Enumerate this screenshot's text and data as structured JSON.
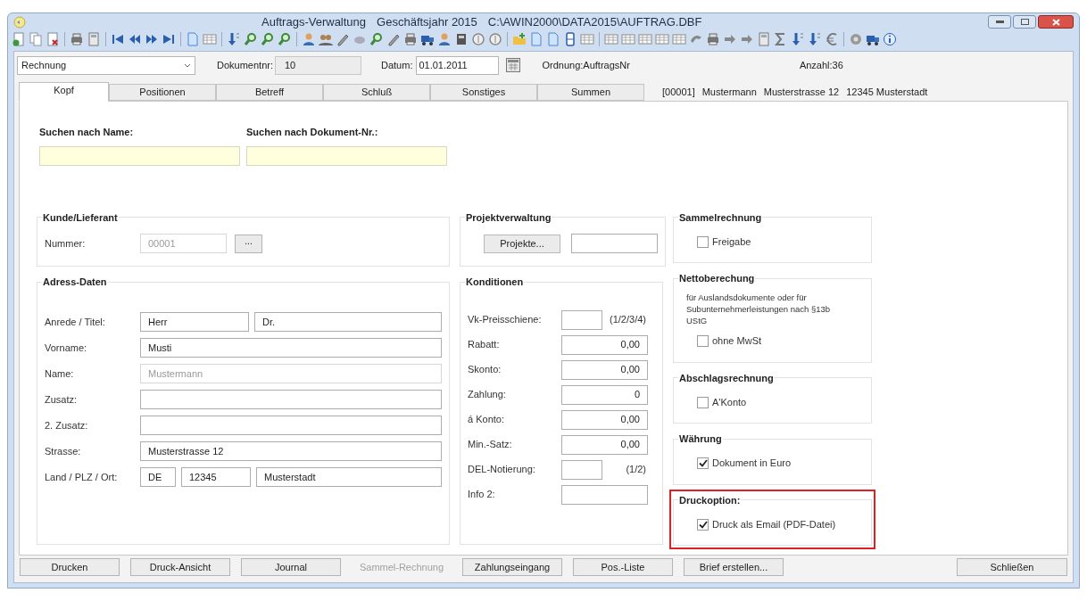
{
  "window": {
    "title_parts": [
      "Auftrags-Verwaltung",
      "Geschäftsjahr 2015",
      "C:\\AWIN2000\\DATA2015\\AUFTRAG.DBF"
    ]
  },
  "document_bar": {
    "type": "Rechnung",
    "number_label": "Dokumentnr:",
    "number": "10",
    "date_label": "Datum:",
    "date": "01.01.2011",
    "order": "Ordnung:AuftragsNr",
    "count": "Anzahl:36"
  },
  "tabs": [
    {
      "label": "Kopf",
      "selected": true
    },
    {
      "label": "Positionen",
      "selected": false
    },
    {
      "label": "Betreff",
      "selected": false
    },
    {
      "label": "Schluß",
      "selected": false
    },
    {
      "label": "Sonstiges",
      "selected": false
    },
    {
      "label": "Summen",
      "selected": false
    }
  ],
  "record_info": [
    "[00001]",
    "Mustermann",
    "Musterstrasse 12",
    "12345 Musterstadt"
  ],
  "search": [
    {
      "label": "Suchen nach Name:"
    },
    {
      "label": "Suchen nach Dokument-Nr.:"
    }
  ],
  "columns": [
    [
      {
        "title": "Kunde/Lieferant",
        "items": [
          {
            "kind": "lookup",
            "label": "Nummer:",
            "inputs": [
              {
                "value": "00001",
                "disabled": true
              }
            ],
            "button": "..."
          }
        ]
      },
      {
        "title": "Adress-Daten",
        "items": [
          {
            "kind": "field",
            "label": "Anrede / Titel:",
            "inputs": [
              {
                "value": "Herr",
                "disabled": false
              },
              {
                "value": "Dr.",
                "disabled": false
              }
            ]
          },
          {
            "kind": "field",
            "label": "Vorname:",
            "inputs": [
              {
                "value": "Musti",
                "disabled": false
              }
            ]
          },
          {
            "kind": "field",
            "label": "Name:",
            "inputs": [
              {
                "value": "Mustermann",
                "disabled": true
              }
            ]
          },
          {
            "kind": "field",
            "label": "Zusatz:",
            "inputs": [
              {
                "disabled": false
              }
            ]
          },
          {
            "kind": "field",
            "label": "2. Zusatz:",
            "inputs": [
              {
                "disabled": false
              }
            ]
          },
          {
            "kind": "field",
            "label": "Strasse:",
            "inputs": [
              {
                "value": "Musterstrasse 12",
                "disabled": false
              }
            ]
          },
          {
            "kind": "field",
            "label": "Land / PLZ / Ort:",
            "inputs": [
              {
                "value": "DE",
                "disabled": false
              },
              {
                "value": "12345",
                "disabled": false
              },
              {
                "value": "Musterstadt",
                "disabled": false
              }
            ]
          }
        ]
      }
    ],
    [
      {
        "title": "Projektverwaltung",
        "items": [
          {
            "kind": "button_field",
            "button": "Projekte..."
          }
        ]
      },
      {
        "title": "Konditionen",
        "items": [
          {
            "kind": "short",
            "label": "Vk-Preisschiene:",
            "suffix": "(1/2/3/4)"
          },
          {
            "kind": "amount",
            "label": "Rabatt:",
            "value": "0,00"
          },
          {
            "kind": "amount",
            "label": "Skonto:",
            "value": "0,00"
          },
          {
            "kind": "amount",
            "label": "Zahlung:",
            "value": "0"
          },
          {
            "kind": "amount",
            "label": "á Konto:",
            "value": "0,00"
          },
          {
            "kind": "amount",
            "label": "Min.-Satz:",
            "value": "0,00"
          },
          {
            "kind": "short",
            "label": "DEL-Notierung:",
            "suffix": "(1/2)"
          },
          {
            "kind": "amount",
            "label": "Info 2:"
          }
        ]
      }
    ],
    [
      {
        "title": "Sammelrechnung",
        "items": [
          {
            "kind": "checkbox",
            "label": "Freigabe",
            "checked": false
          }
        ]
      },
      {
        "title": "Nettoberechung",
        "items": [
          {
            "kind": "note",
            "text": "für Auslandsdokumente oder für Subunternehmerleistungen nach §13b UStG"
          },
          {
            "kind": "checkbox",
            "label": "ohne MwSt",
            "checked": false
          }
        ]
      },
      {
        "title": "Abschlagsrechnung",
        "items": [
          {
            "kind": "checkbox",
            "label": "A'Konto",
            "checked": false
          }
        ]
      },
      {
        "title": "Währung",
        "items": [
          {
            "kind": "checkbox",
            "label": "Dokument in Euro",
            "checked": true
          }
        ]
      },
      {
        "title": "Druckoption:",
        "highlighted": true,
        "items": [
          {
            "kind": "checkbox",
            "label": "Druck als Email (PDF-Datei)",
            "checked": true
          }
        ]
      }
    ]
  ],
  "buttons": [
    {
      "label": "Drucken",
      "disabled": false
    },
    {
      "label": "Druck-Ansicht",
      "disabled": false
    },
    {
      "label": "Journal",
      "disabled": false
    },
    {
      "label": "Sammel-Rechnung",
      "disabled": true
    },
    {
      "label": "Zahlungseingang",
      "disabled": false
    },
    {
      "label": "Pos.-Liste",
      "disabled": false
    },
    {
      "label": "Brief erstellen...",
      "disabled": false
    }
  ],
  "close_button": {
    "label": "Schließen",
    "disabled": false
  }
}
